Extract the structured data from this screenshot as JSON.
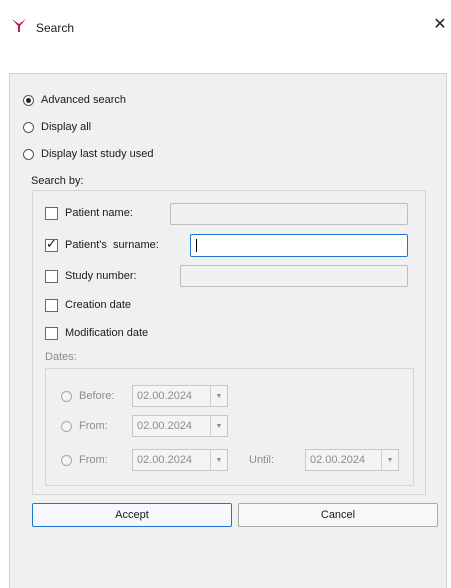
{
  "window": {
    "title": "Search",
    "close_glyph": "✕",
    "icon": "app-logo-icon",
    "accent": "#c2185b"
  },
  "mode": {
    "options": [
      {
        "label": "Advanced search",
        "selected": true
      },
      {
        "label": "Display all",
        "selected": false
      },
      {
        "label": "Display last study used",
        "selected": false
      }
    ]
  },
  "search_by": {
    "label": "Search by:",
    "fields": [
      {
        "label": "Patient name:",
        "checked": false,
        "value": ""
      },
      {
        "label": "Patient's  surname:",
        "checked": true,
        "value": ""
      },
      {
        "label": "Study number:",
        "checked": false,
        "value": ""
      },
      {
        "label": "Creation date",
        "checked": false
      },
      {
        "label": "Modification date",
        "checked": false
      }
    ]
  },
  "dates": {
    "label": "Dates:",
    "before": {
      "label": "Before:",
      "value": "02.00.2024"
    },
    "from1": {
      "label": "From:",
      "value": "02.00.2024"
    },
    "from2": {
      "label": "From:",
      "value": "02.00.2024"
    },
    "until": {
      "label": "Until:",
      "value": "02.00.2024"
    }
  },
  "buttons": {
    "accept": "Accept",
    "cancel": "Cancel"
  },
  "colors": {
    "focus_border": "#1f73d6",
    "disabled_text": "#8c8c8c",
    "panel_bg": "#f0f0f0"
  }
}
